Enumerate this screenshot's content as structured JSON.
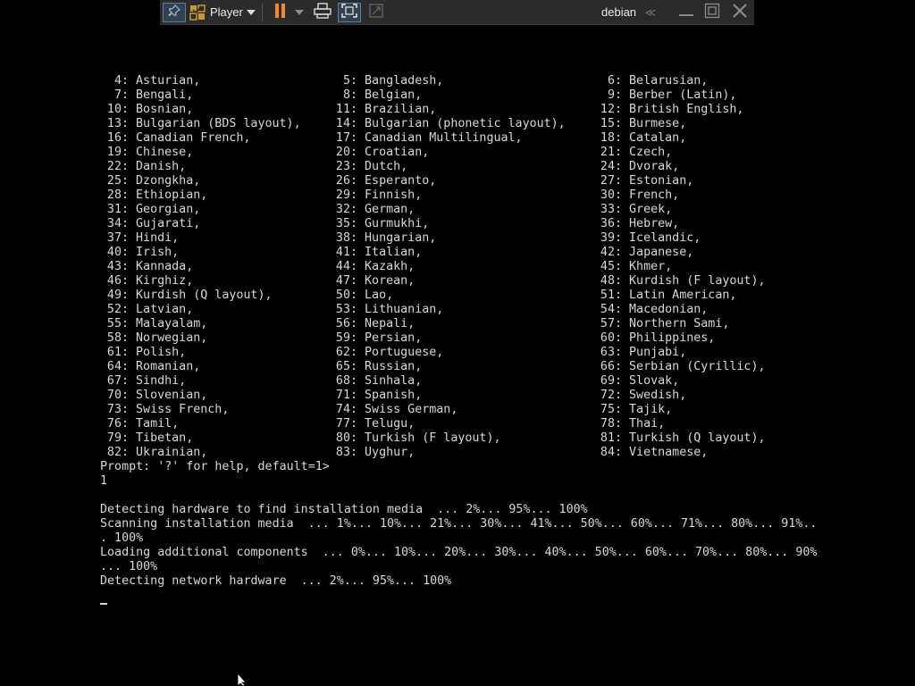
{
  "toolbar": {
    "player_label": "Player",
    "vm_name": "debian",
    "collapse_glyph": "≪",
    "accent_color": "#5b7da8",
    "pause_color": "#f08a2a",
    "icons": [
      "pin-icon",
      "player-logo-icon",
      "dropdown-arrow-icon",
      "pause-icon",
      "ctrl-alt-del-icon",
      "fullscreen-icon",
      "unity-icon",
      "collapse-icon",
      "minimize-icon",
      "restore-icon",
      "close-icon"
    ]
  },
  "console": {
    "keyboard_options": [
      [
        [
          "4:",
          "Asturian,"
        ],
        [
          "5:",
          "Bangladesh,"
        ],
        [
          "6:",
          "Belarusian,"
        ]
      ],
      [
        [
          "7:",
          "Bengali,"
        ],
        [
          "8:",
          "Belgian,"
        ],
        [
          "9:",
          "Berber (Latin),"
        ]
      ],
      [
        [
          "10:",
          "Bosnian,"
        ],
        [
          "11:",
          "Brazilian,"
        ],
        [
          "12:",
          "British English,"
        ]
      ],
      [
        [
          "13:",
          "Bulgarian (BDS layout),"
        ],
        [
          "14:",
          "Bulgarian (phonetic layout),"
        ],
        [
          "15:",
          "Burmese,"
        ]
      ],
      [
        [
          "16:",
          "Canadian French,"
        ],
        [
          "17:",
          "Canadian Multilingual,"
        ],
        [
          "18:",
          "Catalan,"
        ]
      ],
      [
        [
          "19:",
          "Chinese,"
        ],
        [
          "20:",
          "Croatian,"
        ],
        [
          "21:",
          "Czech,"
        ]
      ],
      [
        [
          "22:",
          "Danish,"
        ],
        [
          "23:",
          "Dutch,"
        ],
        [
          "24:",
          "Dvorak,"
        ]
      ],
      [
        [
          "25:",
          "Dzongkha,"
        ],
        [
          "26:",
          "Esperanto,"
        ],
        [
          "27:",
          "Estonian,"
        ]
      ],
      [
        [
          "28:",
          "Ethiopian,"
        ],
        [
          "29:",
          "Finnish,"
        ],
        [
          "30:",
          "French,"
        ]
      ],
      [
        [
          "31:",
          "Georgian,"
        ],
        [
          "32:",
          "German,"
        ],
        [
          "33:",
          "Greek,"
        ]
      ],
      [
        [
          "34:",
          "Gujarati,"
        ],
        [
          "35:",
          "Gurmukhi,"
        ],
        [
          "36:",
          "Hebrew,"
        ]
      ],
      [
        [
          "37:",
          "Hindi,"
        ],
        [
          "38:",
          "Hungarian,"
        ],
        [
          "39:",
          "Icelandic,"
        ]
      ],
      [
        [
          "40:",
          "Irish,"
        ],
        [
          "41:",
          "Italian,"
        ],
        [
          "42:",
          "Japanese,"
        ]
      ],
      [
        [
          "43:",
          "Kannada,"
        ],
        [
          "44:",
          "Kazakh,"
        ],
        [
          "45:",
          "Khmer,"
        ]
      ],
      [
        [
          "46:",
          "Kirghiz,"
        ],
        [
          "47:",
          "Korean,"
        ],
        [
          "48:",
          "Kurdish (F layout),"
        ]
      ],
      [
        [
          "49:",
          "Kurdish (Q layout),"
        ],
        [
          "50:",
          "Lao,"
        ],
        [
          "51:",
          "Latin American,"
        ]
      ],
      [
        [
          "52:",
          "Latvian,"
        ],
        [
          "53:",
          "Lithuanian,"
        ],
        [
          "54:",
          "Macedonian,"
        ]
      ],
      [
        [
          "55:",
          "Malayalam,"
        ],
        [
          "56:",
          "Nepali,"
        ],
        [
          "57:",
          "Northern Sami,"
        ]
      ],
      [
        [
          "58:",
          "Norwegian,"
        ],
        [
          "59:",
          "Persian,"
        ],
        [
          "60:",
          "Philippines,"
        ]
      ],
      [
        [
          "61:",
          "Polish,"
        ],
        [
          "62:",
          "Portuguese,"
        ],
        [
          "63:",
          "Punjabi,"
        ]
      ],
      [
        [
          "64:",
          "Romanian,"
        ],
        [
          "65:",
          "Russian,"
        ],
        [
          "66:",
          "Serbian (Cyrillic),"
        ]
      ],
      [
        [
          "67:",
          "Sindhi,"
        ],
        [
          "68:",
          "Sinhala,"
        ],
        [
          "69:",
          "Slovak,"
        ]
      ],
      [
        [
          "70:",
          "Slovenian,"
        ],
        [
          "71:",
          "Spanish,"
        ],
        [
          "72:",
          "Swedish,"
        ]
      ],
      [
        [
          "73:",
          "Swiss French,"
        ],
        [
          "74:",
          "Swiss German,"
        ],
        [
          "75:",
          "Tajik,"
        ]
      ],
      [
        [
          "76:",
          "Tamil,"
        ],
        [
          "77:",
          "Telugu,"
        ],
        [
          "78:",
          "Thai,"
        ]
      ],
      [
        [
          "79:",
          "Tibetan,"
        ],
        [
          "80:",
          "Turkish (F layout),"
        ],
        [
          "81:",
          "Turkish (Q layout),"
        ]
      ],
      [
        [
          "82:",
          "Ukrainian,"
        ],
        [
          "83:",
          "Uyghur,"
        ],
        [
          "84:",
          "Vietnamese,"
        ]
      ]
    ],
    "prompt": "Prompt: '?' for help, default=1>",
    "input_value": "1",
    "log_lines": [
      "Detecting hardware to find installation media  ... 2%... 95%... 100%",
      "Scanning installation media  ... 1%... 10%... 21%... 30%... 41%... 50%... 60%... 71%... 80%... 91%..",
      ". 100%",
      "Loading additional components  ... 0%... 10%... 20%... 30%... 40%... 50%... 60%... 70%... 80%... 90%",
      "... 100%",
      "Detecting network hardware  ... 2%... 95%... 100%"
    ],
    "text_color": "#d8d8d8",
    "background_color": "#000000"
  }
}
